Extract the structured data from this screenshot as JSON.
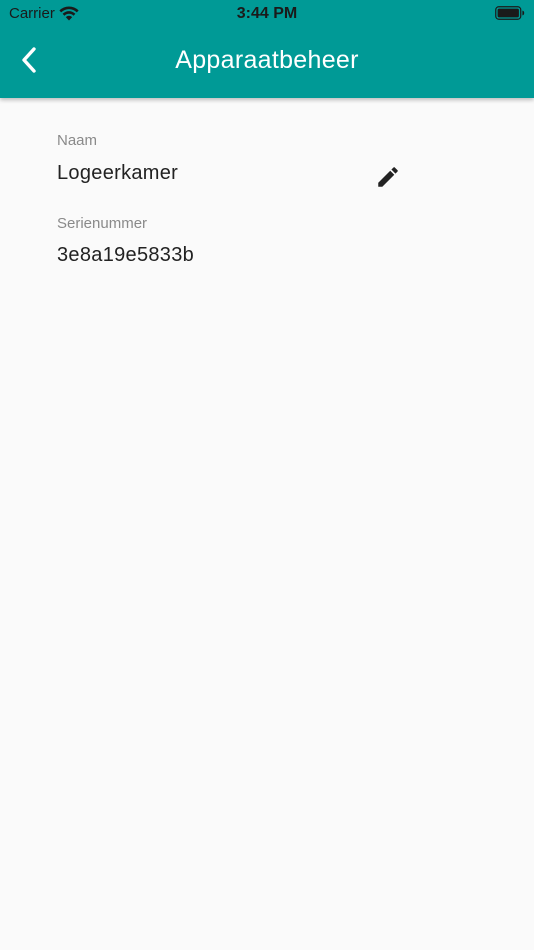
{
  "status_bar": {
    "carrier": "Carrier",
    "time": "3:44 PM",
    "wifi_icon": "wifi-icon",
    "battery_icon": "battery-full-icon"
  },
  "header": {
    "title": "Apparaatbeheer",
    "back_icon": "chevron-left-icon",
    "background_color": "#009a96"
  },
  "device": {
    "name_label": "Naam",
    "name_value": "Logeerkamer",
    "edit_icon": "pencil-icon",
    "serial_label": "Serienummer",
    "serial_value": "3e8a19e5833b"
  },
  "colors": {
    "accent": "#009a96",
    "background": "#fafafa",
    "label": "#8a8a8a",
    "text": "#222222"
  }
}
